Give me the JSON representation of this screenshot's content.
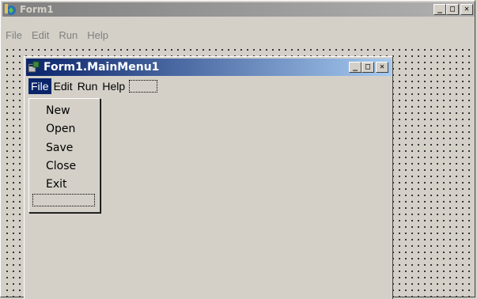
{
  "outer_window": {
    "title": "Form1",
    "icon": "delphi-app-icon",
    "menu": [
      "File",
      "Edit",
      "Run",
      "Help"
    ],
    "buttons": {
      "minimize": "_",
      "maximize": "□",
      "close": "✕"
    }
  },
  "inner_window": {
    "title": "Form1.MainMenu1",
    "icon": "menu-designer-icon",
    "menu": [
      "File",
      "Edit",
      "Run",
      "Help"
    ],
    "active_menu": "File",
    "buttons": {
      "minimize": "_",
      "maximize": "□",
      "close": "✕"
    }
  },
  "dropdown": {
    "items": [
      "New",
      "Open",
      "Save",
      "Close",
      "Exit"
    ]
  },
  "colors": {
    "face": "#d4d0c8",
    "active_title_start": "#0a246a",
    "active_title_end": "#a6caf0",
    "inactive_title": "#808080"
  }
}
